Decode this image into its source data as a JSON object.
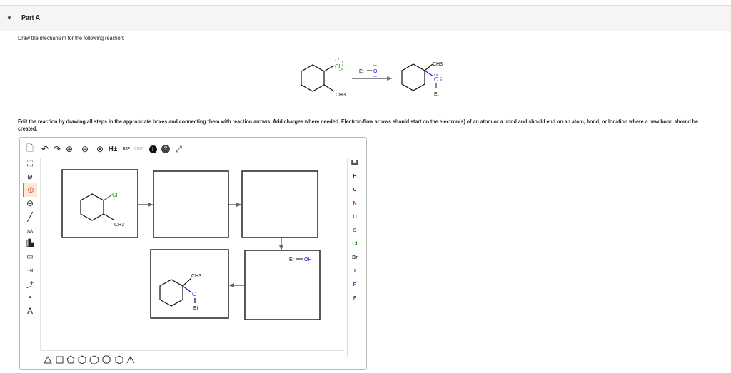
{
  "header": {
    "title": "Part A",
    "caret": "▼"
  },
  "prompt": "Draw the mechanism for the following reaction:",
  "reaction": {
    "reactant_cl": "Cl",
    "reactant_ch3": "CH3",
    "reagent_et": "Et",
    "reagent_oh": "OH",
    "product_ch3": "CH3",
    "product_o": "O",
    "product_et": "Et"
  },
  "instructions": "Edit the reaction by drawing all steps in the appropriate boxes and connecting them with reaction arrows. Add charges where needed. Electron-flow arrows should start on the electron(s) of an atom or a bond and should end on an atom, bond, or location where a new bond should be created.",
  "toolbar": {
    "h_label": "H±",
    "exp": "EXP",
    "cont": "CONT"
  },
  "left_tools": {
    "text_tool": "A"
  },
  "canvas": {
    "box1_cl": "Cl",
    "box1_ch3": "CH3",
    "box4_ch3": "CH3",
    "box4_o": "O",
    "box4_et": "Et",
    "box5_et": "Et",
    "box5_oh": "OH"
  },
  "elements": [
    {
      "symbol": "H",
      "color": "#333333"
    },
    {
      "symbol": "C",
      "color": "#222222"
    },
    {
      "symbol": "N",
      "color": "#b03020"
    },
    {
      "symbol": "O",
      "color": "#1a3ad0"
    },
    {
      "symbol": "S",
      "color": "#1f6b6b"
    },
    {
      "symbol": "Cl",
      "color": "#1a8a1a"
    },
    {
      "symbol": "Br",
      "color": "#333333"
    },
    {
      "symbol": "I",
      "color": "#8a1a6a"
    },
    {
      "symbol": "P",
      "color": "#1a5a9a"
    },
    {
      "symbol": "F",
      "color": "#1a5a9a"
    }
  ],
  "colors": {
    "chlorine": "#1a8a1a",
    "oxygen": "#1a1ad0",
    "active_tool": "#e8602c"
  }
}
